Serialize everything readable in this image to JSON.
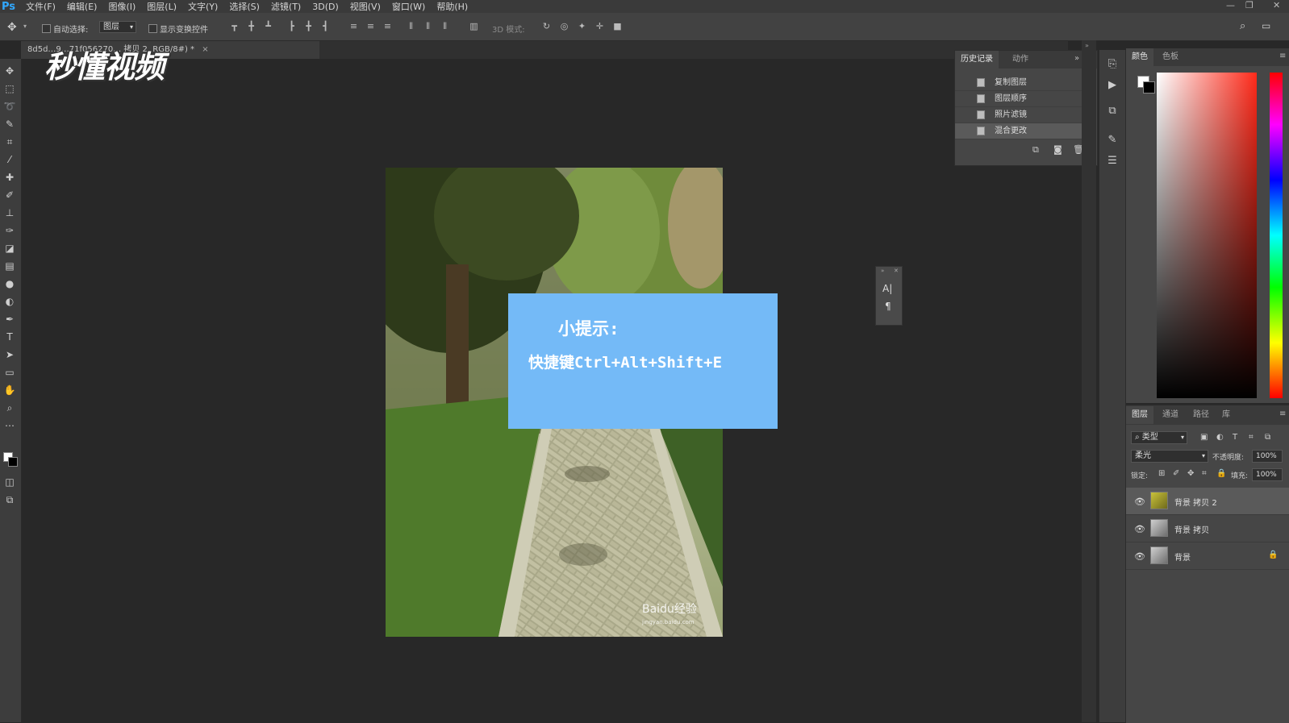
{
  "app": {
    "logo": "Ps"
  },
  "menu": [
    "文件(F)",
    "编辑(E)",
    "图像(I)",
    "图层(L)",
    "文字(Y)",
    "选择(S)",
    "滤镜(T)",
    "3D(D)",
    "视图(V)",
    "窗口(W)",
    "帮助(H)"
  ],
  "options": {
    "auto_select_label": "自动选择:",
    "auto_select_value": "图层",
    "show_transform_label": "显示变换控件",
    "mode_3d_label": "3D 模式:"
  },
  "document": {
    "tab_title": "8d5d…9…71f056270… 拷贝 2, RGB/8#) *",
    "tab_close": "×"
  },
  "watermark": {
    "text": "秒懂视频"
  },
  "tip": {
    "title": "小提示:",
    "text": "快捷键Ctrl+Alt+Shift+E"
  },
  "photo": {
    "credit": "Baidu经验",
    "url": "jingyan.baidu.com"
  },
  "char_panel": {
    "char_icon": "A|",
    "para_icon": "¶"
  },
  "history": {
    "tabs": [
      "历史记录",
      "动作"
    ],
    "items": [
      "复制图层",
      "图层顺序",
      "照片滤镜",
      "混合更改"
    ]
  },
  "color_panel": {
    "tabs": [
      "颜色",
      "色板"
    ]
  },
  "layers": {
    "tabs": [
      "图层",
      "通道",
      "路径",
      "库"
    ],
    "filter_label": "类型",
    "blend_mode": "柔光",
    "opacity_label": "不透明度:",
    "opacity_value": "100%",
    "lock_label": "锁定:",
    "fill_label": "填充:",
    "fill_value": "100%",
    "items": [
      {
        "name": "背景 拷贝 2"
      },
      {
        "name": "背景 拷贝"
      },
      {
        "name": "背景"
      }
    ]
  },
  "colors": {
    "tip_bg": "#74baf7",
    "ps_blue": "#31a8ff"
  }
}
